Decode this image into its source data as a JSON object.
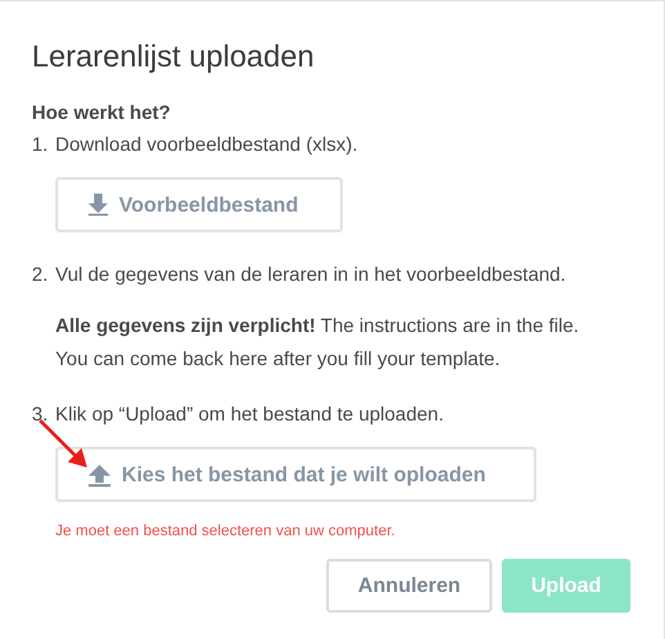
{
  "dialog": {
    "title": "Lerarenlijst uploaden",
    "section_heading": "Hoe werkt het?",
    "steps": [
      {
        "number": "1.",
        "text": "Download voorbeeldbestand (xlsx).",
        "button": {
          "label": "Voorbeeldbestand",
          "kind": "download"
        }
      },
      {
        "number": "2.",
        "text": "Vul de gegevens van de leraren in in het voorbeeldbestand.",
        "note": "**Alle gegevens zijn verplicht!**  The instructions are in the file. You can come back here after you fill your template."
      },
      {
        "number": "3.",
        "text": "Klik op “Upload” om het bestand te uploaden.",
        "button": {
          "label": "Kies het bestand dat je wilt oploaden",
          "kind": "upload"
        }
      }
    ],
    "error": "Je moet een bestand selecteren van uw computer.",
    "buttons": [
      {
        "label": "Annuleren",
        "kind": "secondary",
        "disabled": false
      },
      {
        "label": "Upload",
        "kind": "primary",
        "disabled": true
      }
    ]
  }
}
